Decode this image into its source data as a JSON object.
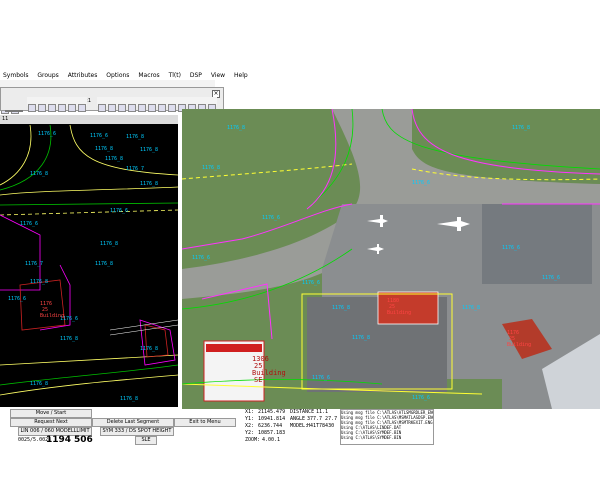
{
  "menu": {
    "items": [
      "Symbols",
      "Groups",
      "Attributes",
      "Options",
      "Macros",
      "Tl(t)",
      "DSP",
      "View",
      "Help"
    ]
  },
  "toolbar": {
    "scale_label": "1:1"
  },
  "left_view": {
    "header_text": "11",
    "labels": [
      "1176_6",
      "1176_6",
      "1176_8",
      "1176_8",
      "1176_8",
      "1176_8",
      "1176_7",
      "1176_8",
      "1176_8",
      "1176_6",
      "1176_6",
      "1176_8",
      "1176_7",
      "1176_8",
      "1176_8",
      "1176_6",
      "1176_6",
      "1176_8",
      "1176_8",
      "1176_8",
      "1176_8"
    ],
    "building_label": [
      "1176",
      "25",
      "Building"
    ]
  },
  "right_view": {
    "labels": [
      "1176_8",
      "1176_8",
      "1176_8",
      "1176_6",
      "1176_6",
      "1176_6",
      "1176_6",
      "1176_8",
      "1176_8",
      "1176_8",
      "1176_6",
      "1176_6",
      "1176_6",
      "1176_6"
    ],
    "building_label_1": [
      "1180",
      "25",
      "Building"
    ],
    "building_label_2": [
      "1176",
      "25",
      "Building"
    ],
    "big_building": [
      "1306",
      "25",
      "Building",
      "SE"
    ]
  },
  "commands": {
    "move_start": "Move / Start",
    "request_next": "Request Next",
    "delete_last_segment": "Delete Last Segment",
    "exit_to_menu": "Exit to Menu",
    "layer_select": "LIN 006 / 060 MODELLLIMIT",
    "symbol_select": "SYM 333 / DS SPOT HEIGHT",
    "sle": "SLE"
  },
  "coords": {
    "code": "0025/5.0023",
    "value1": "1194",
    "value2": "506",
    "x_label": "X1:",
    "x_value": "21145.479",
    "y_label": "Y1:",
    "y_value": "10941.814",
    "x2_label": "X2:",
    "x2_value": "6236.744",
    "y2_label": "Y2:",
    "y2_value": "10857.183",
    "zoom_label": "ZOOM:",
    "zoom_value": "4.00.1",
    "dist_label": "DISTANCE",
    "dist_value": "11.1",
    "angle_label": "ANGLE",
    "angle_value": "377.7 27.7",
    "model_label": "MODEL:",
    "model_value": "H41T78430"
  },
  "log": [
    "Using msg file C:\\ATLAS\\ATLSMGRDLER_ENG.ini",
    "Using msg file C:\\ATLAS\\MSMATLASDSP.ENG",
    "Using msg file C:\\ATLAS\\MSMTRKEXIT.ENG for",
    "Using C:\\ATLAS\\LINDEF.DAT",
    "Using C:\\ATLAS\\SYMDEF.BIN",
    "Using C:\\ATLAS\\SYMDEF.BIN"
  ]
}
